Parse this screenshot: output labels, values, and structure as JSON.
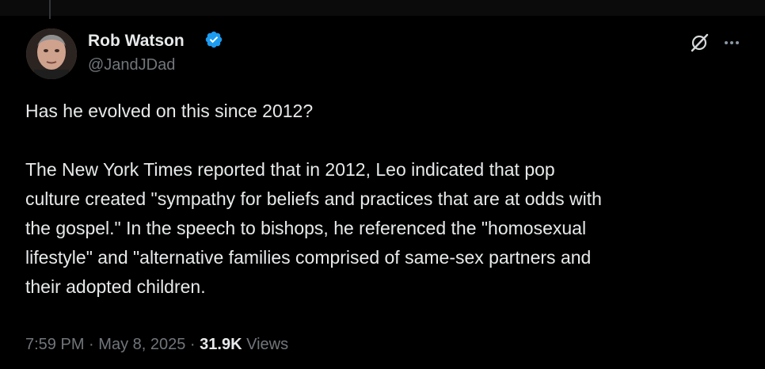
{
  "author": {
    "display_name": "Rob Watson",
    "handle": "@JandJDad",
    "verified": true
  },
  "tweet": {
    "paragraph1": "Has he evolved on this since 2012?",
    "paragraph2_lines": [
      "The New York Times reported that in 2012, Leo indicated that pop",
      "culture created \"sympathy for beliefs and practices that are at odds with",
      "the gospel.\" In the speech to bishops, he referenced the \"homosexual",
      "lifestyle\" and \"alternative families comprised of same-sex partners and",
      "their adopted children."
    ]
  },
  "meta": {
    "time": "7:59 PM",
    "separator": "·",
    "date": "May 8, 2025",
    "views_count": "31.9K",
    "views_label": "Views"
  },
  "icons": {
    "verified": "verified-badge-icon",
    "grok": "grok-icon",
    "more": "more-options-icon"
  },
  "colors": {
    "background": "#000000",
    "text_primary": "#e7e9ea",
    "text_secondary": "#71767b",
    "verified_blue": "#1d9bf0"
  }
}
